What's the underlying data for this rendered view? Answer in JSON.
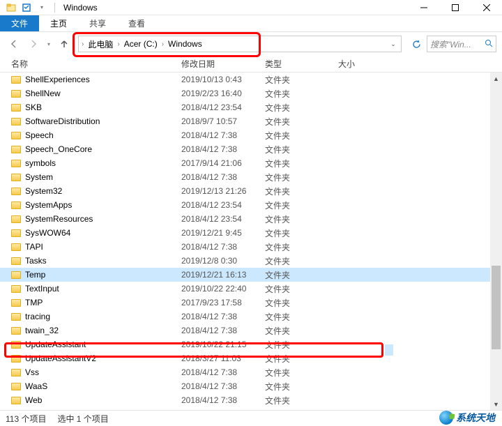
{
  "titlebar": {
    "title": "Windows"
  },
  "ribbon": {
    "file": "文件",
    "home": "主页",
    "share": "共享",
    "view": "查看"
  },
  "breadcrumb": {
    "items": [
      "此电脑",
      "Acer (C:)",
      "Windows"
    ]
  },
  "search": {
    "placeholder": "搜索\"Win..."
  },
  "columns": {
    "name": "名称",
    "date": "修改日期",
    "type": "类型",
    "size": "大小"
  },
  "files": [
    {
      "name": "ShellExperiences",
      "date": "2019/10/13 0:43",
      "type": "文件夹"
    },
    {
      "name": "ShellNew",
      "date": "2019/2/23 16:40",
      "type": "文件夹"
    },
    {
      "name": "SKB",
      "date": "2018/4/12 23:54",
      "type": "文件夹"
    },
    {
      "name": "SoftwareDistribution",
      "date": "2018/9/7 10:57",
      "type": "文件夹"
    },
    {
      "name": "Speech",
      "date": "2018/4/12 7:38",
      "type": "文件夹"
    },
    {
      "name": "Speech_OneCore",
      "date": "2018/4/12 7:38",
      "type": "文件夹"
    },
    {
      "name": "symbols",
      "date": "2017/9/14 21:06",
      "type": "文件夹"
    },
    {
      "name": "System",
      "date": "2018/4/12 7:38",
      "type": "文件夹"
    },
    {
      "name": "System32",
      "date": "2019/12/13 21:26",
      "type": "文件夹"
    },
    {
      "name": "SystemApps",
      "date": "2018/4/12 23:54",
      "type": "文件夹"
    },
    {
      "name": "SystemResources",
      "date": "2018/4/12 23:54",
      "type": "文件夹"
    },
    {
      "name": "SysWOW64",
      "date": "2019/12/21 9:45",
      "type": "文件夹"
    },
    {
      "name": "TAPI",
      "date": "2018/4/12 7:38",
      "type": "文件夹"
    },
    {
      "name": "Tasks",
      "date": "2019/12/8 0:30",
      "type": "文件夹"
    },
    {
      "name": "Temp",
      "date": "2019/12/21 16:13",
      "type": "文件夹",
      "selected": true
    },
    {
      "name": "TextInput",
      "date": "2019/10/22 22:40",
      "type": "文件夹"
    },
    {
      "name": "TMP",
      "date": "2017/9/23 17:58",
      "type": "文件夹"
    },
    {
      "name": "tracing",
      "date": "2018/4/12 7:38",
      "type": "文件夹"
    },
    {
      "name": "twain_32",
      "date": "2018/4/12 7:38",
      "type": "文件夹"
    },
    {
      "name": "UpdateAssistant",
      "date": "2019/10/22 21:15",
      "type": "文件夹"
    },
    {
      "name": "UpdateAssistantV2",
      "date": "2018/3/27 11:03",
      "type": "文件夹"
    },
    {
      "name": "Vss",
      "date": "2018/4/12 7:38",
      "type": "文件夹"
    },
    {
      "name": "WaaS",
      "date": "2018/4/12 7:38",
      "type": "文件夹"
    },
    {
      "name": "Web",
      "date": "2018/4/12 7:38",
      "type": "文件夹"
    }
  ],
  "status": {
    "count": "113 个项目",
    "selected": "选中 1 个项目"
  },
  "watermark": "系统天地"
}
